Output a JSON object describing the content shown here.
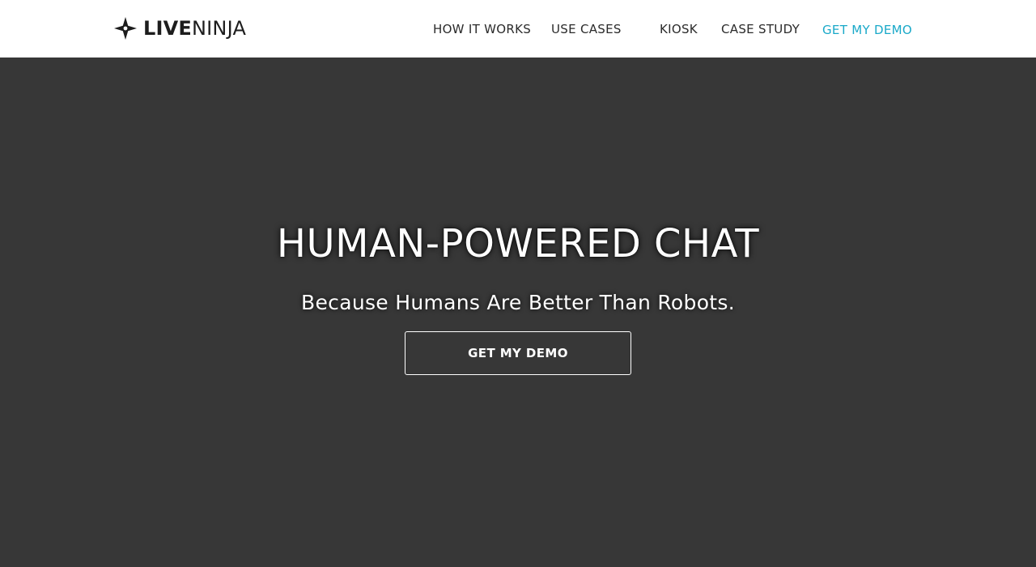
{
  "header": {
    "logo": {
      "bold_text": "LIVE",
      "light_text": "NINJA",
      "icon": "ninja-star-icon"
    },
    "nav": {
      "items": [
        {
          "label": "HOW IT WORKS"
        },
        {
          "label": "USE CASES"
        },
        {
          "label": "KIOSK"
        },
        {
          "label": "CASE STUDY"
        },
        {
          "label": "GET MY DEMO"
        }
      ]
    }
  },
  "hero": {
    "title": "HUMAN-POWERED CHAT",
    "subtitle": "Because Humans Are Better Than Robots.",
    "cta_label": "GET MY DEMO"
  },
  "colors": {
    "header_bg": "#ffffff",
    "hero_bg": "#373737",
    "accent": "#1aa9c9",
    "nav_text": "#2b2b2b",
    "hero_text": "#ffffff"
  }
}
